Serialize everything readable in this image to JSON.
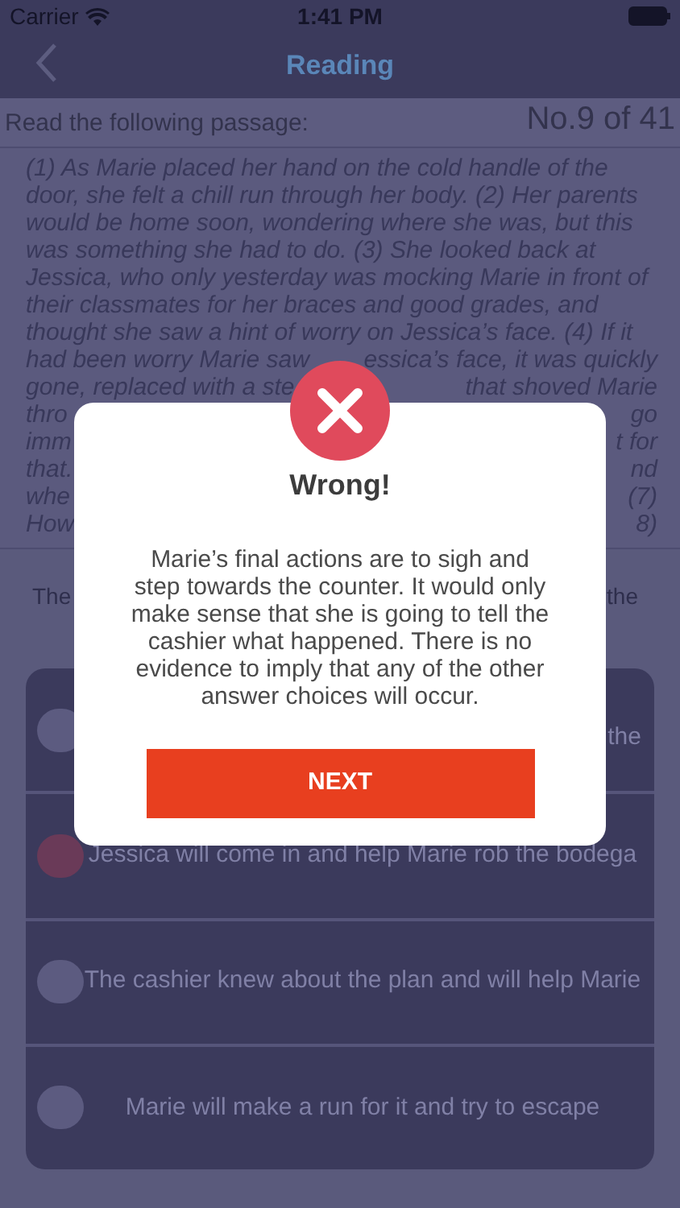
{
  "status_bar": {
    "carrier": "Carrier",
    "time": "1:41 PM"
  },
  "nav": {
    "title": "Reading"
  },
  "header": {
    "instruction": "Read the following passage:",
    "counter": "No.9 of 41"
  },
  "passage_lines": [
    {
      "left": "(1) As Marie placed her hand on the cold handle of the"
    },
    {
      "left": "door, she felt a chill run through her body. (2) Her parents"
    },
    {
      "left": "would be home soon, wondering where she was, but this"
    },
    {
      "left": "was something she had to do. (3) She looked back at"
    },
    {
      "left": "Jessica, who only yesterday was mocking Marie in front of"
    },
    {
      "left": "their classmates for her braces and good grades, and"
    },
    {
      "left": "thought she saw a hint of worry on Jessica’s face. (4) If it"
    },
    {
      "left": "had been worry Marie saw",
      "right": "essica’s face, it was quickly"
    },
    {
      "left": "gone, replaced with a ste",
      "right": "that shoved Marie"
    },
    {
      "left": "thro",
      "right": "go"
    },
    {
      "left": "imm",
      "right": "t for"
    },
    {
      "left": "that.",
      "right": "nd"
    },
    {
      "left": "whe",
      "right": "(7)"
    },
    {
      "left": "How",
      "right": "8)"
    }
  ],
  "question": {
    "left": "The",
    "right": "the"
  },
  "answers": [
    {
      "kind": "clipped",
      "text": "the",
      "selected": false
    },
    {
      "kind": "full",
      "text": "Jessica will come in and help Marie rob the bodega",
      "selected": true
    },
    {
      "kind": "full",
      "text": "The cashier knew about the plan and will help Marie",
      "selected": false
    },
    {
      "kind": "full",
      "text": "Marie will make a run for it and try to escape",
      "selected": false
    }
  ],
  "dialog": {
    "correct": false,
    "title": "Wrong!",
    "message": "Marie’s final actions are to sigh and step towards the counter. It would only make sense that she is going to tell the cashier what happened. There is no evidence to imply that any of the other answer choices will occur.",
    "button": "NEXT"
  }
}
